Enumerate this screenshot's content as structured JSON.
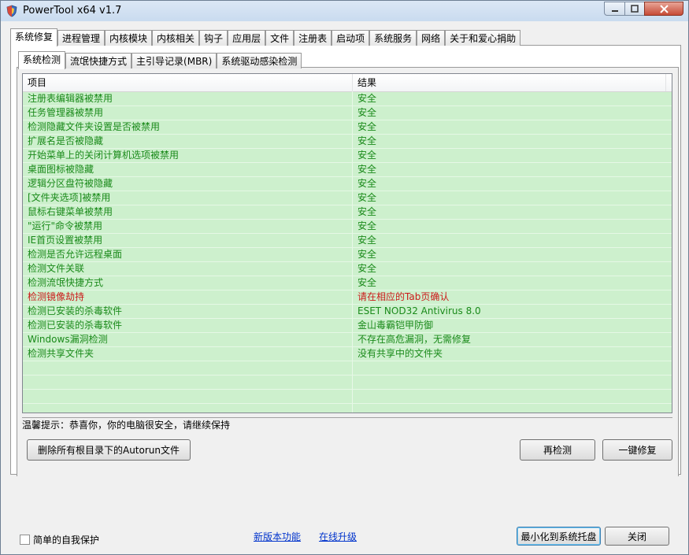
{
  "window": {
    "title": "PowerTool x64 v1.7"
  },
  "main_tabs": [
    "系统修复",
    "进程管理",
    "内核模块",
    "内核相关",
    "钩子",
    "应用层",
    "文件",
    "注册表",
    "启动项",
    "系统服务",
    "网络",
    "关于和爱心捐助"
  ],
  "sub_tabs": [
    "系统检测",
    "流氓快捷方式",
    "主引导记录(MBR)",
    "系统驱动感染检测"
  ],
  "list": {
    "headers": [
      "项目",
      "结果"
    ],
    "rows": [
      {
        "item": "注册表编辑器被禁用",
        "result": "安全",
        "status": "ok"
      },
      {
        "item": "任务管理器被禁用",
        "result": "安全",
        "status": "ok"
      },
      {
        "item": "检测隐藏文件夹设置是否被禁用",
        "result": "安全",
        "status": "ok"
      },
      {
        "item": "扩展名是否被隐藏",
        "result": "安全",
        "status": "ok"
      },
      {
        "item": "开始菜单上的关闭计算机选项被禁用",
        "result": "安全",
        "status": "ok"
      },
      {
        "item": "桌面图标被隐藏",
        "result": "安全",
        "status": "ok"
      },
      {
        "item": "逻辑分区盘符被隐藏",
        "result": "安全",
        "status": "ok"
      },
      {
        "item": "[文件夹选项]被禁用",
        "result": "安全",
        "status": "ok"
      },
      {
        "item": "鼠标右键菜单被禁用",
        "result": "安全",
        "status": "ok"
      },
      {
        "item": "\"运行\"命令被禁用",
        "result": "安全",
        "status": "ok"
      },
      {
        "item": "IE首页设置被禁用",
        "result": "安全",
        "status": "ok"
      },
      {
        "item": "检测是否允许远程桌面",
        "result": "安全",
        "status": "ok"
      },
      {
        "item": "检测文件关联",
        "result": "安全",
        "status": "ok"
      },
      {
        "item": "检测流氓快捷方式",
        "result": "安全",
        "status": "ok"
      },
      {
        "item": "检测镜像劫持",
        "result": "请在相应的Tab页确认",
        "status": "warn"
      },
      {
        "item": "检测已安装的杀毒软件",
        "result": "ESET NOD32 Antivirus 8.0",
        "status": "ok"
      },
      {
        "item": "检测已安装的杀毒软件",
        "result": "金山毒霸铠甲防御",
        "status": "ok"
      },
      {
        "item": "Windows漏洞检测",
        "result": "不存在高危漏洞，无需修复",
        "status": "ok"
      },
      {
        "item": "检测共享文件夹",
        "result": "没有共享中的文件夹",
        "status": "ok"
      }
    ]
  },
  "colors": {
    "ok_text": "#1a8a1a",
    "warn_text": "#cc1a1a",
    "row_bg": "#cdf0cd"
  },
  "hint": "温馨提示：恭喜你，你的电脑很安全，请继续保持",
  "buttons": {
    "delete_autorun": "删除所有根目录下的Autorun文件",
    "recheck": "再检测",
    "one_click_fix": "一键修复",
    "minimize_tray": "最小化到系统托盘",
    "close": "关闭"
  },
  "footer": {
    "self_protect": "简单的自我保护",
    "new_features": "新版本功能",
    "online_upgrade": "在线升级"
  }
}
